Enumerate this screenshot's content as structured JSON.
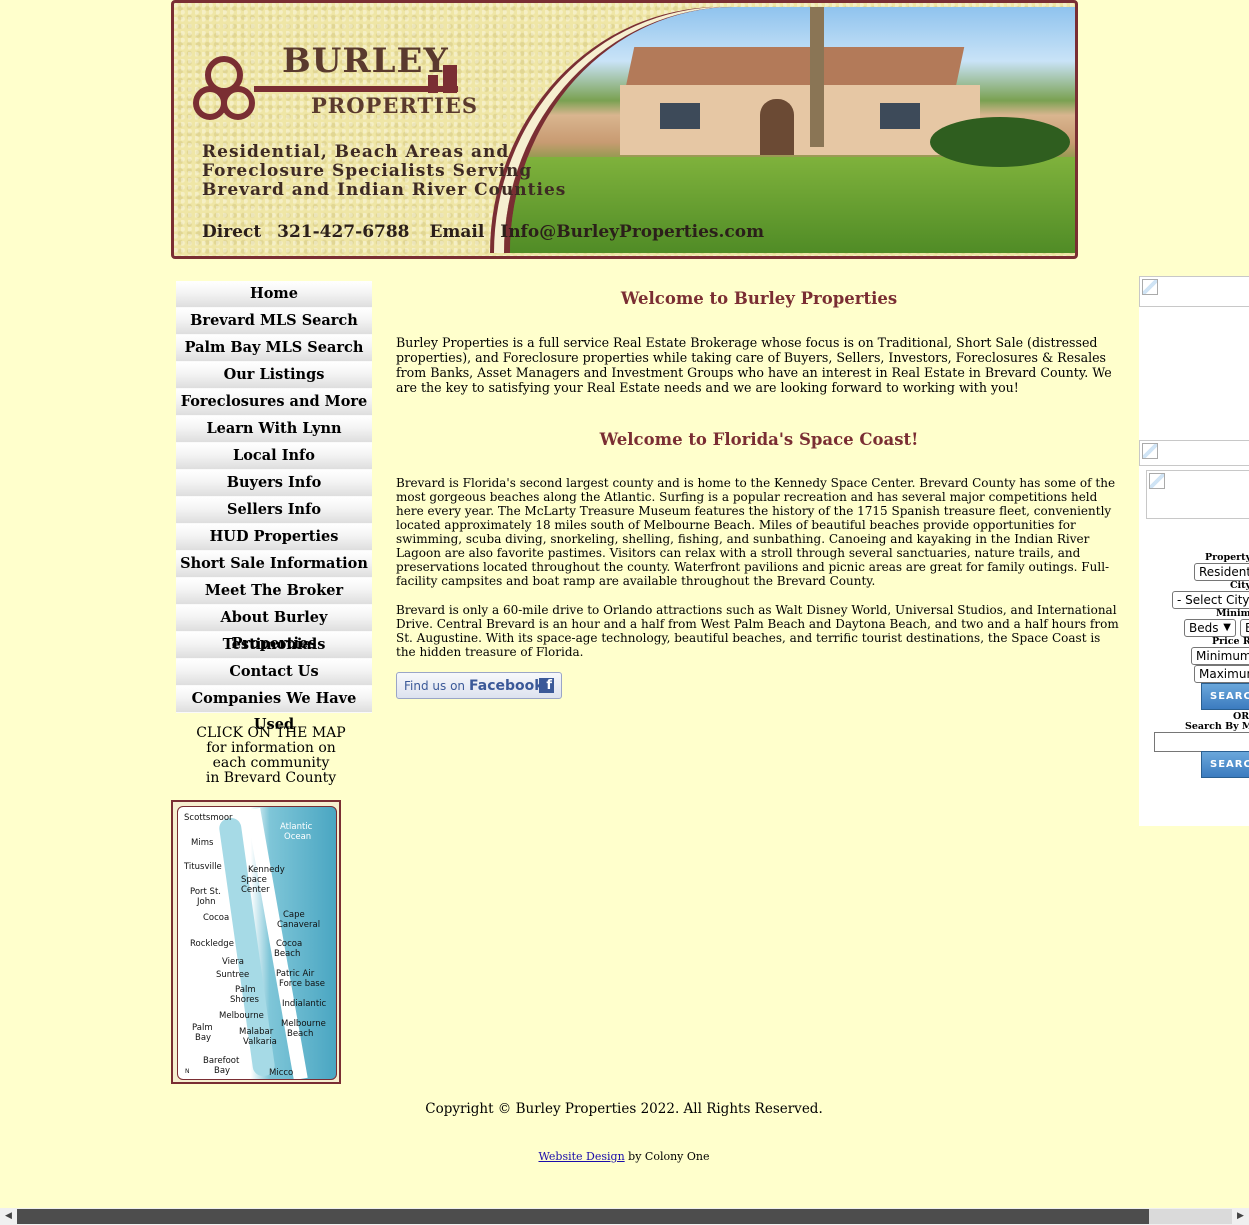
{
  "banner": {
    "brand_line1": "BURLEY",
    "brand_line2": "PROPERTIES",
    "tagline_1": "Residential, Beach Areas and",
    "tagline_2": "Foreclosure Specialists Serving",
    "tagline_3": "Brevard and Indian River Counties",
    "direct_label": "Direct",
    "phone": "321-427-6788",
    "email_label": "Email",
    "email": "Info@BurleyProperties.com"
  },
  "nav": [
    "Home",
    "Brevard MLS Search",
    "Palm Bay MLS Search",
    "Our Listings",
    "Foreclosures and More",
    "Learn With Lynn",
    "Local Info",
    "Buyers Info",
    "Sellers Info",
    "HUD Properties",
    "Short Sale Information",
    "Meet The Broker",
    "About Burley Properties",
    "Testimonials",
    "Contact Us",
    "Companies We Have Used"
  ],
  "map_caption": {
    "line1": "CLICK ON THE MAP",
    "line2": "for information on",
    "line3": "each community",
    "line4": "in Brevard County"
  },
  "map_labels": {
    "scottsmoor": "Scottsmoor",
    "atlantic": "Atlantic",
    "ocean": "Ocean",
    "mims": "Mims",
    "titusville": "Titusville",
    "kennedy": "Kennedy",
    "space": "Space",
    "center": "Center",
    "port_st": "Port St.",
    "john": "John",
    "cocoa": "Cocoa",
    "cape": "Cape",
    "canaveral": "Canaveral",
    "rockledge": "Rockledge",
    "cocoa2": "Cocoa",
    "beach": "Beach",
    "viera": "Viera",
    "suntree": "Suntree",
    "patric_air": "Patric Air",
    "force_base": "Force base",
    "palm": "Palm",
    "shores": "Shores",
    "indialantic": "Indialantic",
    "melbourne": "Melbourne",
    "melbourne2": "Melbourne",
    "beach2": "Beach",
    "palm2": "Palm",
    "bay": "Bay",
    "malabar": "Malabar",
    "valkaria": "Valkaria",
    "barefoot": "Barefoot",
    "bay2": "Bay",
    "micco": "Micco",
    "north": "N"
  },
  "main": {
    "welcome_heading": "Welcome to Burley Properties",
    "intro": "Burley Properties is a full service Real Estate Brokerage whose focus is on Traditional, Short Sale (distressed properties), and Foreclosure properties while taking care of Buyers, Sellers, Investors, Foreclosures & Resales from Banks, Asset Managers and Investment Groups who have an interest in Real Estate in Brevard County. We are the key to satisfying your Real Estate needs and we are looking forward to working with you!",
    "space_heading": "Welcome to Florida's Space Coast!",
    "para1": "Brevard is Florida's second largest county and is home to the Kennedy Space Center. Brevard County has some of the most gorgeous beaches along the Atlantic.  Surfing is a popular recreation and has several major competitions held here every year. The McLarty Treasure Museum features the history of the 1715 Spanish treasure fleet, conveniently located approximately 18 miles south of Melbourne Beach. Miles of beautiful beaches provide opportunities for swimming, scuba diving, snorkeling, shelling, fishing, and sunbathing.  Canoeing and kayaking in the Indian River Lagoon are also favorite pastimes. Visitors can relax with a stroll through several sanctuaries, nature trails, and preservations located throughout the county. Waterfront pavilions and picnic areas are great for family outings. Full-facility campsites and boat ramp are available throughout the Brevard County.",
    "para2": "Brevard is only a 60-mile drive to Orlando attractions such as Walt Disney World, Universal Studios, and International Drive. Central Brevard is an hour and a half from West Palm Beach and Daytona Beach, and two and a half hours from St. Augustine.  With its space-age technology, beautiful beaches, and terrific tourist destinations, the Space Coast is the hidden treasure of Florida.",
    "facebook_prefix": "Find us on",
    "facebook_word": "Facebook",
    "facebook_glyph": "f"
  },
  "search": {
    "property_type_label": "Property T",
    "property_type_value": "Residenti",
    "city_label": "City",
    "city_value": "- Select City -",
    "minimum_label": "Minimu",
    "beds_value": "Beds",
    "baths_value": "B",
    "price_label": "Price Ra",
    "min_price": "Minimum",
    "max_price": "Maximum",
    "search_button": "SEARCH",
    "or_label": "OR",
    "mls_label": "Search By ML",
    "search_button2": "SEARCH"
  },
  "footer": {
    "copyright": "Copyright © Burley Properties 2022. All Rights Reserved.",
    "design_link": "Website Design",
    "design_by": " by Colony One"
  }
}
